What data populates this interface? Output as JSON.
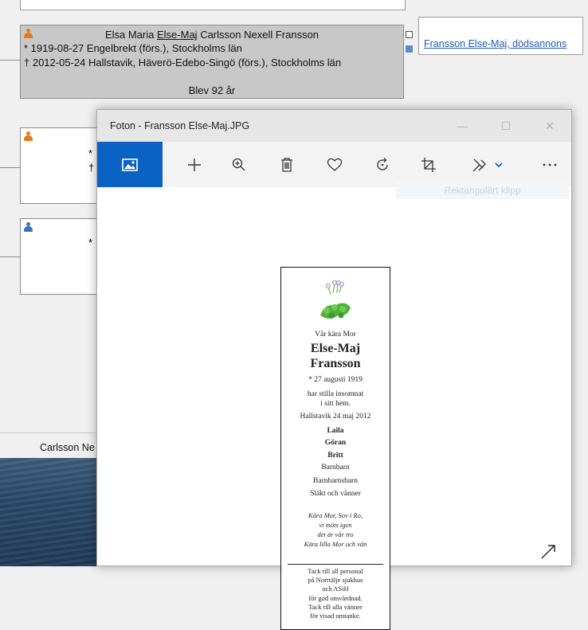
{
  "tree": {
    "main_person": {
      "first_names_pre": "Elsa Maria ",
      "first_name_underlined": "Else-Maj",
      "surnames": " Carlsson Nexell Fransson",
      "birth": "* 1919-08-27 Engelbrekt (förs.), Stockholms län",
      "death": "† 2012-05-24 Hallstavik, Häverö-Edebo-Singö (förs.), Stockholms län",
      "age": "Blev 92 år"
    },
    "source_link": "Fransson Else-Maj, dödsannons",
    "card2": {
      "birth_mark": "*",
      "death_mark": "†"
    },
    "card3": {
      "birth_mark": "*"
    },
    "tab_label": "Carlsson Ne"
  },
  "photos": {
    "title": "Foton - Fransson Else-Maj.JPG",
    "window": {
      "minimize": "—",
      "maximize": "☐",
      "close": "✕"
    },
    "toolbar": [
      "image-icon",
      "add-icon",
      "zoom-in-icon",
      "delete-icon",
      "heart-icon",
      "rotate-icon",
      "crop-icon",
      "edit-icon",
      "more-icon"
    ],
    "tooltip": "Rektangulärt klipp",
    "accent_color": "#0a63c4"
  },
  "notice": {
    "intro": "Vår kära Mor",
    "name1": "Else-Maj",
    "name2": "Fransson",
    "born": "* 27 augusti 1919",
    "line1": "har stilla insomnat",
    "line2": "i sitt hem.",
    "place_date": "Hallstavik 24 maj 2012",
    "child1": "Laila",
    "child2": "Göran",
    "child3": "Britt",
    "rel1": "Barnbarn",
    "rel2": "Barnbarnsbarn",
    "rel3": "Släkt och vänner",
    "verse1": "Kära Mor, Sov i Ro,",
    "verse2": "vi möts igen",
    "verse3": "det är vår tro",
    "verse4": "Kära lilla Mor och vän",
    "thanks1": "Tack till all personal",
    "thanks2": "på Norrtälje sjukhus",
    "thanks3": "och ASiH",
    "thanks4": "för god omvårdnad.",
    "thanks5": "Tack till alla vänner",
    "thanks6": "för visad omtanke."
  }
}
